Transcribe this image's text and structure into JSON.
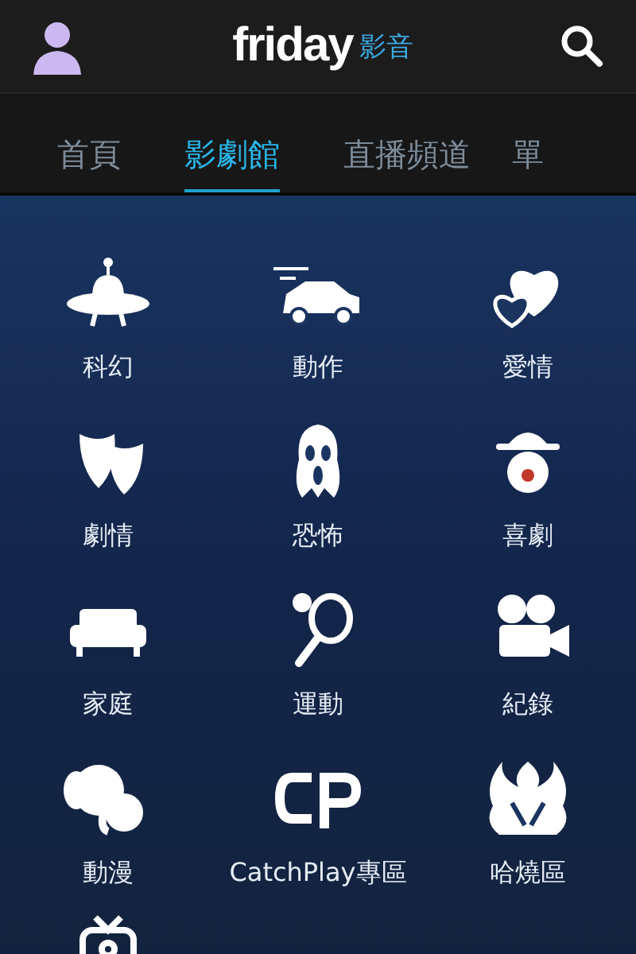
{
  "header": {
    "logo": "friday",
    "logo_suffix": "影音"
  },
  "tabs": [
    {
      "label": "首頁",
      "selected": false
    },
    {
      "label": "影劇館",
      "selected": true
    },
    {
      "label": "直播頻道",
      "selected": false
    },
    {
      "label": "單",
      "selected": false
    }
  ],
  "genres": [
    {
      "label": "科幻"
    },
    {
      "label": "動作"
    },
    {
      "label": "愛情"
    },
    {
      "label": "劇情"
    },
    {
      "label": "恐怖"
    },
    {
      "label": "喜劇"
    },
    {
      "label": "家庭"
    },
    {
      "label": "運動"
    },
    {
      "label": "紀錄"
    },
    {
      "label": "動漫"
    },
    {
      "label": "CatchPlay專區"
    },
    {
      "label": "哈燒區"
    }
  ]
}
